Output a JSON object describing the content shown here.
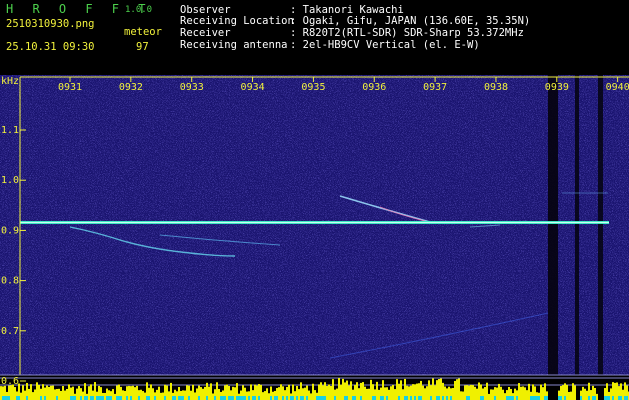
{
  "header": {
    "app_title": "H R O F F T",
    "app_version": "1.0.0",
    "file_name": "2510310930.png",
    "datetime": "25.10.31 09:30",
    "meteor_label": "meteor",
    "meteor_count": "97",
    "info": [
      {
        "label": "Observer",
        "value": ": Takanori Kawachi"
      },
      {
        "label": "Receiving Location",
        "value": ": Ogaki, Gifu, JAPAN (136.60E, 35.35N)"
      },
      {
        "label": "Receiver",
        "value": ": R820T2(RTL-SDR) SDR-Sharp 53.372MHz"
      },
      {
        "label": "Receiving antenna",
        "value": ": 2el-HB9CV Vertical (el. E-W)"
      }
    ]
  },
  "axes": {
    "unit": "kHz",
    "time_ticks": [
      "0931",
      "0932",
      "0933",
      "0934",
      "0935",
      "0936",
      "0937",
      "0938",
      "0939",
      "0940"
    ],
    "freq_ticks": [
      "1.1",
      "1.0",
      "0.9",
      "0.8",
      "0.7",
      "0.6"
    ]
  },
  "colors": {
    "background": "#1a1470",
    "noise": "#3a30c8",
    "carrier": "#40f0c8",
    "labels": "#f2f23c",
    "text": "#ffffff"
  }
}
